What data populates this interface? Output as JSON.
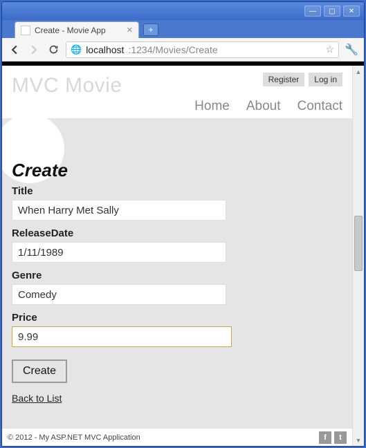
{
  "window": {
    "tab_title": "Create - Movie App"
  },
  "browser": {
    "url_host": "localhost",
    "url_port_path": ":1234/Movies/Create"
  },
  "header": {
    "brand": "MVC Movie",
    "auth": {
      "register": "Register",
      "login": "Log in"
    },
    "nav": {
      "home": "Home",
      "about": "About",
      "contact": "Contact"
    }
  },
  "page": {
    "title": "Create",
    "fields": {
      "title": {
        "label": "Title",
        "value": "When Harry Met Sally"
      },
      "release": {
        "label": "ReleaseDate",
        "value": "1/11/1989"
      },
      "genre": {
        "label": "Genre",
        "value": "Comedy"
      },
      "price": {
        "label": "Price",
        "value": "9.99"
      }
    },
    "submit_label": "Create",
    "back_link": "Back to List"
  },
  "footer": {
    "text": "© 2012 - My ASP.NET MVC Application"
  }
}
